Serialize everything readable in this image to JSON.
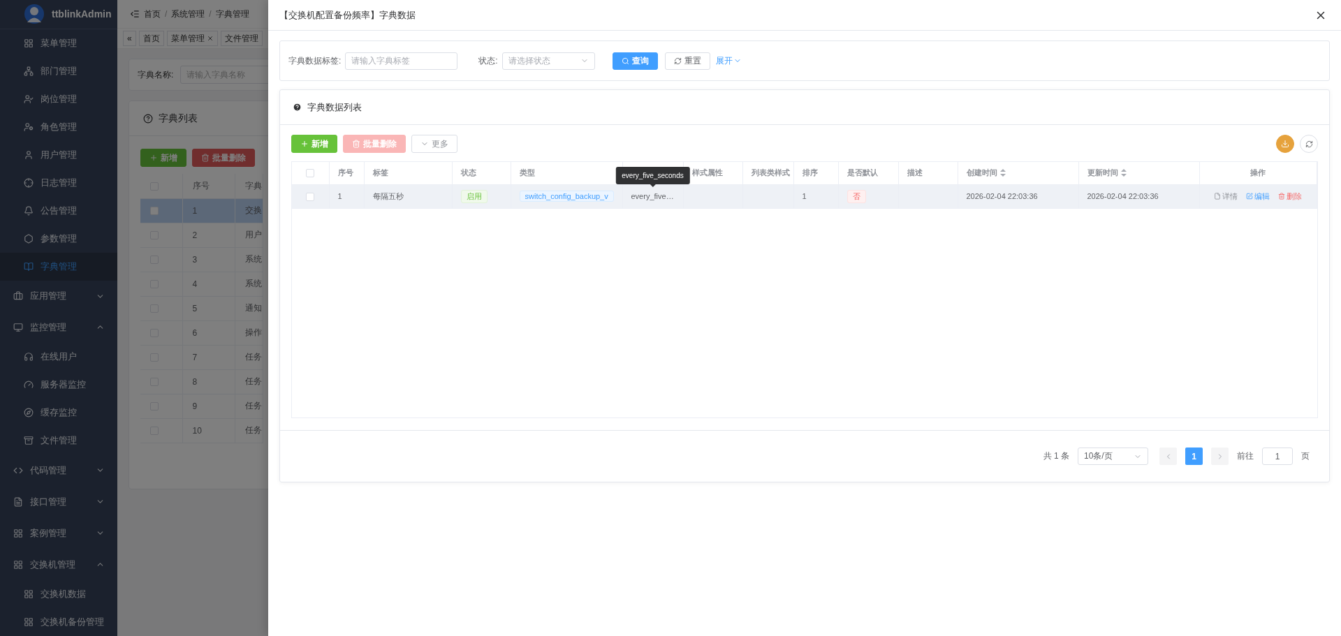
{
  "sidebar": {
    "brand": "ttblinkAdmin",
    "items": [
      {
        "label": "菜单管理",
        "selected": false
      },
      {
        "label": "部门管理",
        "selected": false
      },
      {
        "label": "岗位管理",
        "selected": false
      },
      {
        "label": "角色管理",
        "selected": false
      },
      {
        "label": "用户管理",
        "selected": false
      },
      {
        "label": "日志管理",
        "selected": false
      },
      {
        "label": "公告管理",
        "selected": false
      },
      {
        "label": "参数管理",
        "selected": false
      },
      {
        "label": "字典管理",
        "selected": true
      }
    ],
    "groups": [
      {
        "label": "应用管理",
        "expanded": false
      },
      {
        "label": "监控管理",
        "expanded": true,
        "children": [
          {
            "label": "在线用户",
            "selected": false
          },
          {
            "label": "服务器监控",
            "selected": false
          },
          {
            "label": "缓存监控",
            "selected": false
          },
          {
            "label": "文件管理",
            "selected": false
          }
        ]
      },
      {
        "label": "代码管理",
        "expanded": false
      },
      {
        "label": "接口管理",
        "expanded": false
      },
      {
        "label": "案例管理",
        "expanded": false
      },
      {
        "label": "交换机管理",
        "expanded": true,
        "children": [
          {
            "label": "交换机数据",
            "selected": false
          },
          {
            "label": "交换机备份管理",
            "selected": false
          }
        ]
      }
    ]
  },
  "header": {
    "breadcrumb": [
      "首页",
      "系统管理",
      "字典管理"
    ],
    "separator": "/",
    "collapse_icon": "«"
  },
  "tabs": [
    {
      "label": "首页",
      "closable": false
    },
    {
      "label": "菜单管理",
      "closable": true
    },
    {
      "label": "文件管理",
      "closable": false
    }
  ],
  "search": {
    "label": "字典名称:",
    "placeholder": "请输入字典名称"
  },
  "list_card": {
    "title": "字典列表",
    "all_checked": false,
    "buttons": [
      {
        "label": "新增",
        "kind": "add"
      },
      {
        "label": "批量删除",
        "kind": "delete"
      }
    ],
    "columns": [
      "序号",
      "字典"
    ],
    "rows": [
      {
        "index": "1",
        "name": "交换",
        "selected": true,
        "checked": false
      },
      {
        "index": "2",
        "name": "用户",
        "selected": false,
        "checked": false
      },
      {
        "index": "3",
        "name": "系统",
        "selected": false,
        "checked": false
      },
      {
        "index": "4",
        "name": "系统",
        "selected": false,
        "checked": false
      },
      {
        "index": "5",
        "name": "通知",
        "selected": false,
        "checked": false
      },
      {
        "index": "6",
        "name": "操作",
        "selected": false,
        "checked": false
      },
      {
        "index": "7",
        "name": "任务",
        "selected": false,
        "checked": false
      },
      {
        "index": "8",
        "name": "任务",
        "selected": false,
        "checked": false
      },
      {
        "index": "9",
        "name": "任务",
        "selected": false,
        "checked": false
      },
      {
        "index": "10",
        "name": "任务",
        "selected": false,
        "checked": false
      }
    ]
  },
  "drawer": {
    "title": "【交换机配置备份频率】字典数据",
    "filters": {
      "label_field": {
        "label": "字典数据标签:",
        "placeholder": "请输入字典标签"
      },
      "status_field": {
        "label": "状态:",
        "placeholder": "请选择状态"
      },
      "query": "查询",
      "reset": "重置",
      "expand": "展开"
    },
    "card_title": "字典数据列表",
    "all_checked": false,
    "toolbar": [
      {
        "label": "新增",
        "kind": "add"
      },
      {
        "label": "批量删除",
        "kind": "delete"
      },
      {
        "label": "更多",
        "kind": "more"
      }
    ],
    "columns": [
      {
        "label": "序号"
      },
      {
        "label": "标签"
      },
      {
        "label": "状态"
      },
      {
        "label": "类型"
      },
      {
        "tooltip": "every_five_seconds"
      },
      {
        "label": "样式属性"
      },
      {
        "label": "列表类样式"
      },
      {
        "label": "排序"
      },
      {
        "label": "是否默认"
      },
      {
        "label": "描述"
      },
      {
        "label": "创建时间",
        "sortable": true
      },
      {
        "label": "更新时间",
        "sortable": true
      },
      {
        "label": "操作"
      }
    ],
    "rows": [
      {
        "hovered": true,
        "checked": false,
        "index": "1",
        "label": "每隔五秒",
        "status": {
          "text": "启用",
          "kind": "success"
        },
        "type": "switch_config_backup_v",
        "value": "every_five…",
        "sort": "1",
        "is_default": {
          "text": "否",
          "kind": "danger"
        },
        "created": "2026-02-04 22:03:36",
        "updated": "2026-02-04 22:03:36",
        "actions": [
          {
            "label": "详情",
            "kind": "info"
          },
          {
            "label": "编辑",
            "kind": "edit"
          },
          {
            "label": "删除",
            "kind": "delete"
          }
        ]
      }
    ],
    "pagination": {
      "total": "共 1 条",
      "page_size": "10条/页",
      "pages": [
        {
          "label": "1",
          "selected": true
        }
      ],
      "goto_label": "前往",
      "goto_value": "1",
      "goto_suffix": "页"
    }
  }
}
